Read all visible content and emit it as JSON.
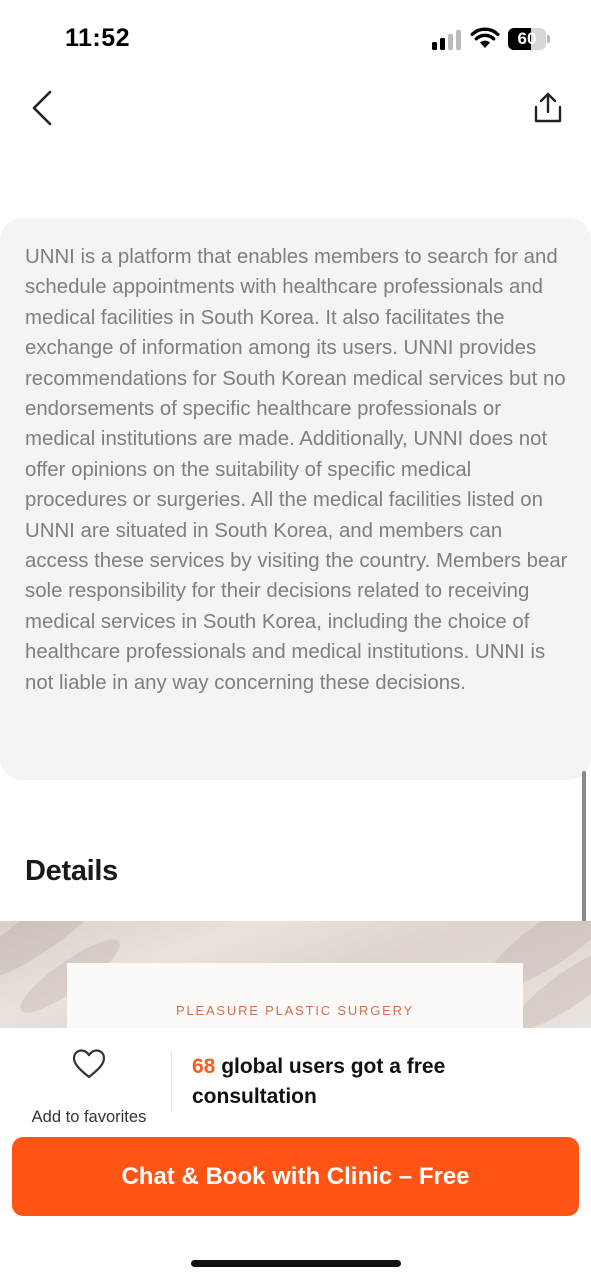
{
  "status_bar": {
    "time": "11:52",
    "battery_percent": 60,
    "battery_label": "60",
    "icons": [
      "signal-icon",
      "wifi-icon",
      "battery-icon"
    ]
  },
  "nav": {
    "back_icon": "chevron-left-icon",
    "share_icon": "share-icon"
  },
  "disclaimer": {
    "text": "UNNI is a platform that enables members to search for and schedule appointments with healthcare professionals and medical facilities in South Korea. It also facilitates the exchange of information among its users. UNNI provides recommendations for South Korean medical services but no endorsements of specific healthcare professionals or medical institutions are made. Additionally, UNNI does not offer opinions on the suitability of specific medical procedures or surgeries. All the medical facilities listed on UNNI are situated in South Korea, and members can access these services by visiting the country. Members bear sole responsibility for their decisions related to receiving medical services in South Korea, including the choice of healthcare professionals and medical institutions. UNNI is not liable in any way concerning these decisions."
  },
  "details": {
    "heading": "Details",
    "image_caption": "PLEASURE PLASTIC SURGERY"
  },
  "bottom_bar": {
    "favorite_label": "Add to favorites",
    "favorite_icon": "heart-icon",
    "consult_count": "68",
    "consult_text": " global users got a free consultation",
    "cta_label": "Chat & Book with Clinic – Free"
  },
  "colors": {
    "accent": "#ff5414",
    "count_highlight": "#ff5a1f",
    "card_background": "#f4f4f5",
    "muted_text": "#7e7e83"
  }
}
